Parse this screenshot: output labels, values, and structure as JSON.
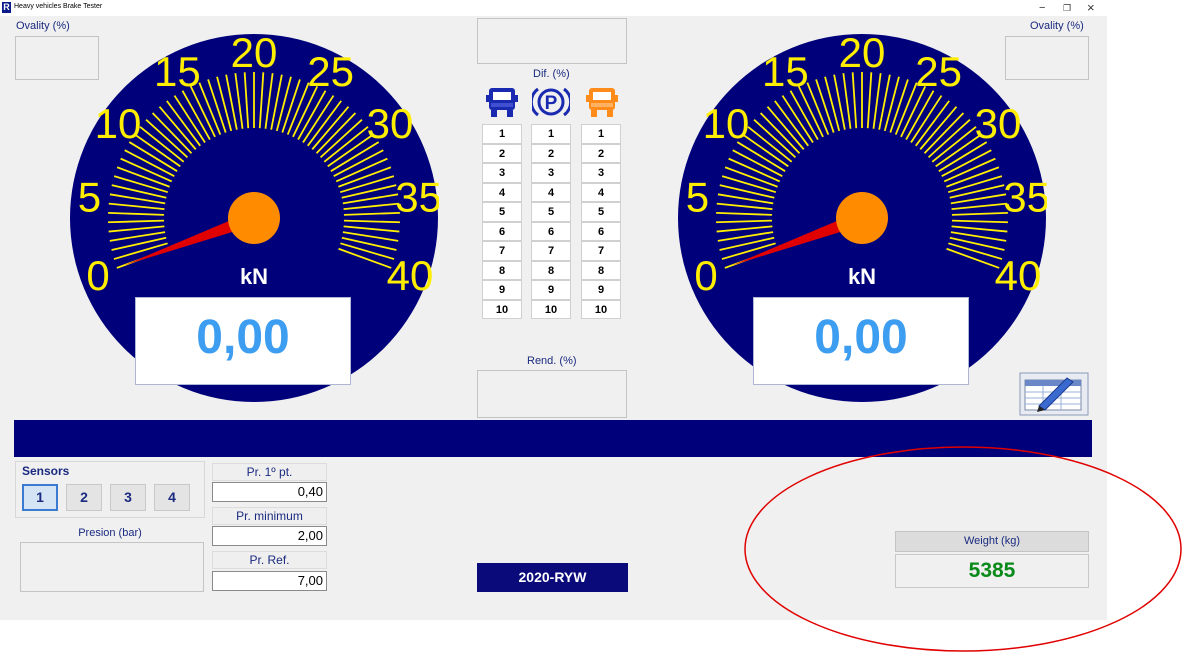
{
  "window": {
    "title": "Heavy vehicles Brake Tester",
    "app_icon": "R",
    "minimize": "−",
    "maximize": "❐",
    "close": "×"
  },
  "left": {
    "ovality_label": "Ovality (%)",
    "unit": "kN",
    "value": "0,00",
    "needle_value": 0
  },
  "right": {
    "ovality_label": "Ovality (%)",
    "unit": "kN",
    "value": "0,00",
    "needle_value": 0
  },
  "gauge": {
    "scale_labels": [
      "0",
      "5",
      "10",
      "15",
      "20",
      "25",
      "30",
      "35",
      "40"
    ],
    "min": 0,
    "max": 40,
    "face_color": "#00007a",
    "tick_color": "#ffee00",
    "hub_color": "#ff8c00",
    "needle_color": "#e00000"
  },
  "center": {
    "dif_label": "Dif. (%)",
    "rend_label": "Rend. (%)",
    "icons": [
      "truck-icon-blue",
      "parking-brake-icon",
      "truck-icon-orange"
    ],
    "parking_symbol": "P",
    "columns": [
      [
        "1",
        "2",
        "3",
        "4",
        "5",
        "6",
        "7",
        "8",
        "9",
        "10"
      ],
      [
        "1",
        "2",
        "3",
        "4",
        "5",
        "6",
        "7",
        "8",
        "9",
        "10"
      ],
      [
        "1",
        "2",
        "3",
        "4",
        "5",
        "6",
        "7",
        "8",
        "9",
        "10"
      ]
    ]
  },
  "sensors": {
    "title": "Sensors",
    "buttons": [
      "1",
      "2",
      "3",
      "4"
    ],
    "active": "1"
  },
  "pressure": {
    "label": "Presion (bar)"
  },
  "fields": [
    {
      "label": "Pr. 1º pt.",
      "value": "0,40"
    },
    {
      "label": "Pr. minimum",
      "value": "2,00"
    },
    {
      "label": "Pr. Ref.",
      "value": "7,00"
    }
  ],
  "plate": "2020-RYW",
  "weight": {
    "label": "Weight (kg)",
    "value": "5385",
    "color": "#0a8a1a"
  },
  "annotation_color": "#e00000"
}
